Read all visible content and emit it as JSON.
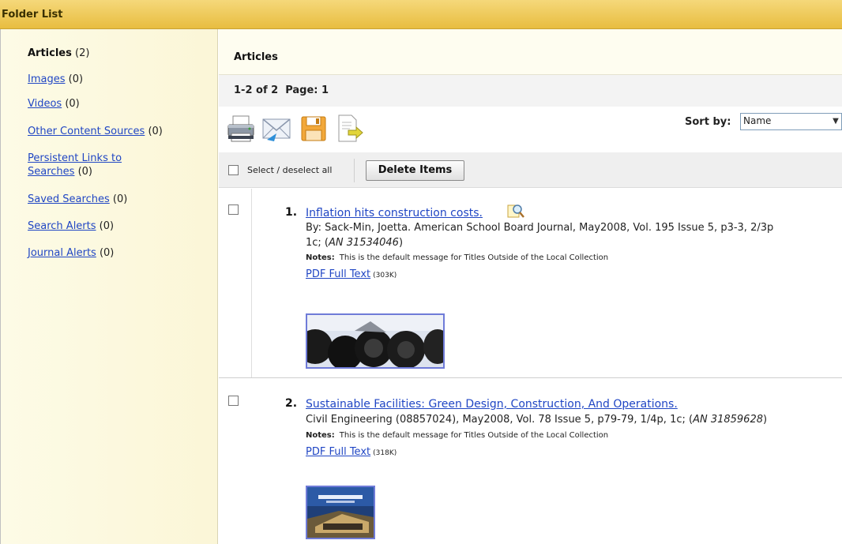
{
  "window": {
    "title": "Folder List"
  },
  "sidebar": {
    "items": [
      {
        "label": "Articles",
        "count": "(2)"
      },
      {
        "label": "Images",
        "count": "(0)"
      },
      {
        "label": "Videos",
        "count": "(0)"
      },
      {
        "label": "Other Content Sources",
        "count": "(0)"
      },
      {
        "label_line1": "Persistent Links to",
        "label_line2": "Searches",
        "count": "(0)"
      },
      {
        "label": "Saved Searches",
        "count": "(0)"
      },
      {
        "label": "Search Alerts",
        "count": "(0)"
      },
      {
        "label": "Journal Alerts",
        "count": "(0)"
      }
    ]
  },
  "main": {
    "heading": "Articles",
    "pagination": "1-2 of 2  Page: 1",
    "toolbar": {
      "icons": [
        "print-icon",
        "email-icon",
        "save-icon",
        "export-icon"
      ],
      "sort_label": "Sort by:",
      "sort_value": "Name"
    },
    "select_all_label": "Select / deselect all",
    "delete_button": "Delete Items",
    "results": [
      {
        "number": "1.",
        "title": "Inflation hits construction costs.",
        "line1": "By: Sack-Min, Joetta. American School Board Journal, May2008, Vol. 195 Issue 5, p3-3, 2/3p",
        "line2_prefix": "1c; (",
        "line2_an": "AN 31534046",
        "line2_suffix": ")",
        "notes_label": "Notes:",
        "notes_text": "This is the default message for Titles Outside of the Local Collection",
        "pdf_label": "PDF Full Text",
        "pdf_size": "(303K)"
      },
      {
        "number": "2.",
        "title": "Sustainable Facilities: Green Design, Construction, And Operations.",
        "line1_prefix": "Civil Engineering (08857024), May2008, Vol. 78 Issue 5, p79-79, 1/4p, 1c; (",
        "line1_an": "AN 31859628",
        "line1_suffix": ")",
        "notes_label": "Notes:",
        "notes_text": "This is the default message for Titles Outside of the Local Collection",
        "pdf_label": "PDF Full Text",
        "pdf_size": "(318K)"
      }
    ]
  },
  "colors": {
    "title_bar": "#e8bd40",
    "sidebar_bg": "#fbf6d7",
    "link": "#2046c4",
    "thumb_border": "#6f7bd8"
  }
}
